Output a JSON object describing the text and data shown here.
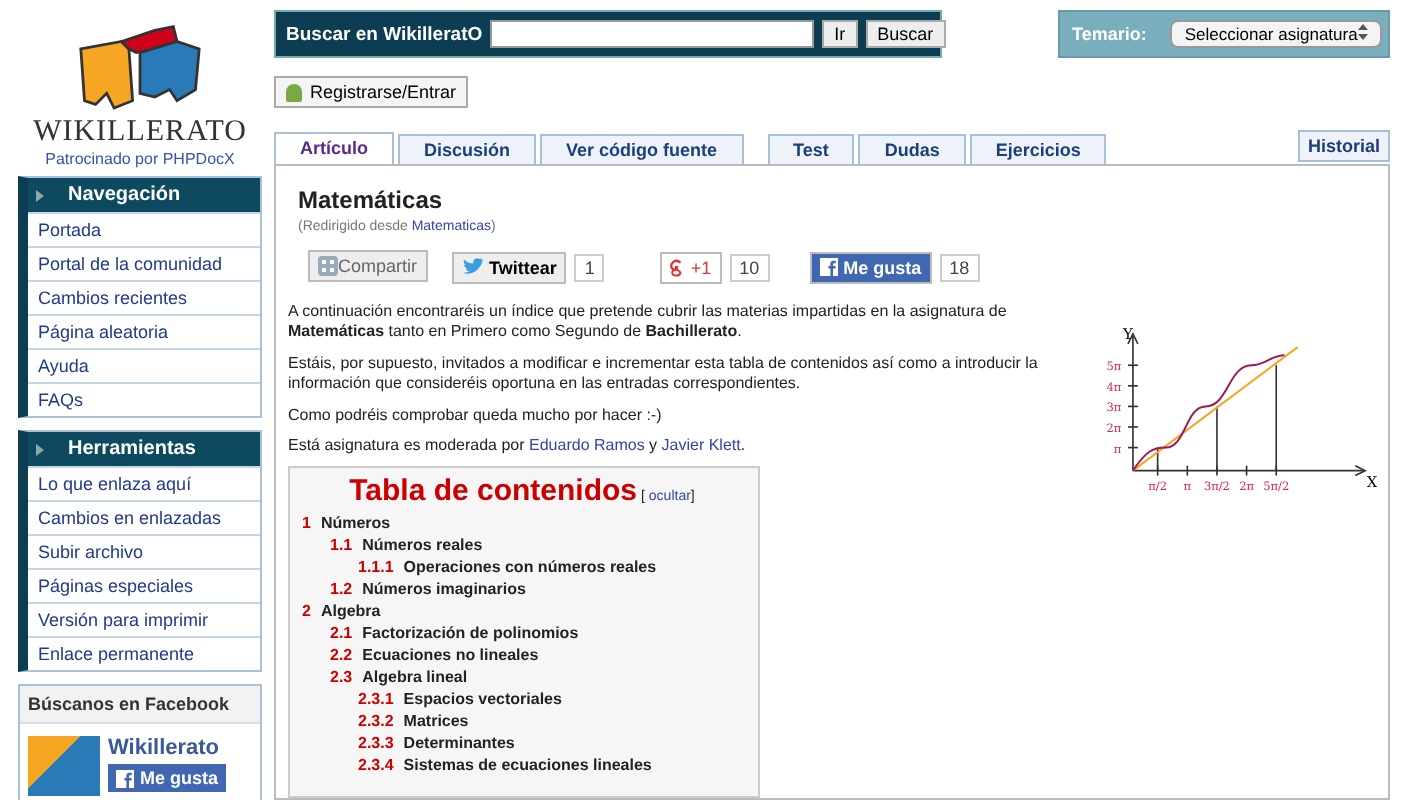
{
  "logo": {
    "name": "WIKILLERATO",
    "sponsor": "Patrocinado por PHPDocX"
  },
  "search": {
    "label": "Buscar en WikilleratO",
    "go": "Ir",
    "search": "Buscar"
  },
  "temario": {
    "label": "Temario:",
    "select": "Seleccionar asignatura"
  },
  "login": "Registrarse/Entrar",
  "tabs": [
    {
      "label": "Artículo",
      "selected": true
    },
    {
      "label": "Discusión",
      "selected": false
    },
    {
      "label": "Ver código fuente",
      "selected": false
    },
    {
      "label": "Test",
      "selected": false
    },
    {
      "label": "Dudas",
      "selected": false
    },
    {
      "label": "Ejercicios",
      "selected": false
    }
  ],
  "history": "Historial",
  "sidebar": [
    {
      "title": "Navegación",
      "items": [
        "Portada",
        "Portal de la comunidad",
        "Cambios recientes",
        "Página aleatoria",
        "Ayuda",
        "FAQs"
      ]
    },
    {
      "title": "Herramientas",
      "items": [
        "Lo que enlaza aquí",
        "Cambios en enlazadas",
        "Subir archivo",
        "Páginas especiales",
        "Versión para imprimir",
        "Enlace permanente"
      ]
    }
  ],
  "facebook": {
    "title": "Búscanos en Facebook",
    "page": "Wikillerato",
    "like": "Me gusta"
  },
  "article": {
    "title": "Matemáticas",
    "redirect_prefix": "(Redirigido desde ",
    "redirect_link": "Matematicas",
    "redirect_suffix": ")",
    "share": [
      {
        "kind": "share",
        "label": "Compartir"
      },
      {
        "kind": "twitter",
        "label": "Twittear",
        "count": "1"
      },
      {
        "kind": "gplus",
        "label": "+1",
        "count": "10"
      },
      {
        "kind": "facebook",
        "label": "Me gusta",
        "count": "18"
      }
    ],
    "paragraphs": [
      "A continuación encontraréis un índice que pretende cubrir las materias impartidas en la asignatura de **Matemáticas** tanto en Primero como Segundo de **Bachillerato**.",
      "Estáis, por supuesto, invitados a modificar e incrementar esta tabla de contenidos así como a introducir la información que consideréis oportuna en las entradas correspondientes.",
      "Como podréis comprobar queda mucho por hacer :-)"
    ],
    "moderated_prefix": "Está asignatura es moderada por ",
    "moderators": [
      "Eduardo Ramos",
      "Javier Klett"
    ],
    "moderated_join": " y ",
    "moderated_suffix": "."
  },
  "toc": {
    "title": "Tabla de contenidos",
    "hide_open": "[ ",
    "hide": "ocultar",
    "hide_close": "]",
    "items": [
      {
        "number": "1",
        "title": "Números",
        "children": [
          {
            "number": "1.1",
            "title": "Números reales",
            "children": [
              {
                "number": "1.1.1",
                "title": "Operaciones con números reales"
              }
            ]
          },
          {
            "number": "1.2",
            "title": "Números imaginarios"
          }
        ]
      },
      {
        "number": "2",
        "title": "Algebra",
        "children": [
          {
            "number": "2.1",
            "title": "Factorización de polinomios"
          },
          {
            "number": "2.2",
            "title": "Ecuaciones no lineales"
          },
          {
            "number": "2.3",
            "title": "Algebra lineal",
            "children": [
              {
                "number": "2.3.1",
                "title": "Espacios vectoriales"
              },
              {
                "number": "2.3.2",
                "title": "Matrices"
              },
              {
                "number": "2.3.3",
                "title": "Determinantes"
              },
              {
                "number": "2.3.4",
                "title": "Sistemas de ecuaciones lineales"
              }
            ]
          }
        ]
      }
    ]
  },
  "graph": {
    "y_axis": "Y",
    "x_axis": "X",
    "y_labels": [
      "5π",
      "4π",
      "3π",
      "2π",
      "π"
    ],
    "x_labels": [
      "π/2",
      "π",
      "3π/2",
      "2π",
      "5π/2"
    ]
  }
}
